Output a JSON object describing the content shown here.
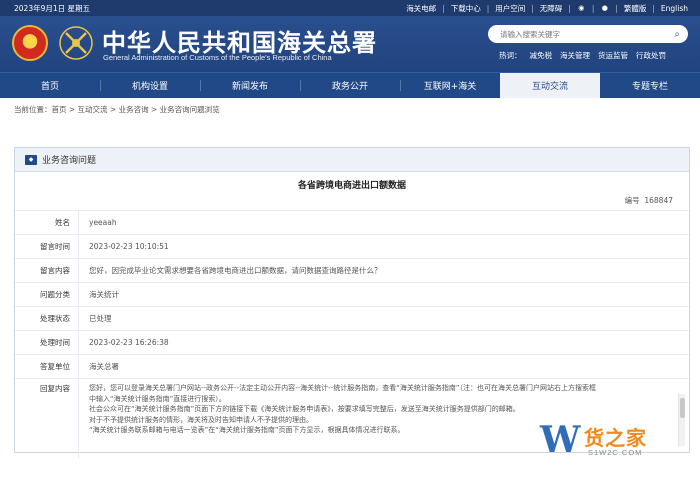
{
  "topbar": {
    "date": "2023年9月1日 星期五",
    "links": [
      "海关电邮",
      "下载中心",
      "用户空间",
      "无障碍"
    ],
    "lang_simplified": "繁體版",
    "lang_english": "English"
  },
  "header": {
    "title_cn": "中华人民共和国海关总署",
    "title_en": "General Administration of Customs of the People's Republic of China",
    "search_placeholder": "请输入搜索关键字",
    "hot_label": "热词：",
    "hot_words": [
      "减免税",
      "海关管理",
      "货运监管",
      "行政处罚"
    ]
  },
  "nav": {
    "items": [
      "首页",
      "机构设置",
      "新闻发布",
      "政务公开",
      "互联网+海关",
      "互动交流",
      "专题专栏"
    ],
    "active": "互动交流"
  },
  "breadcrumb": "当前位置：首页 > 互动交流 > 业务咨询 > 业务咨询问题浏览",
  "panel": {
    "title": "业务咨询问题",
    "question_title": "各省跨境电商进出口额数据",
    "serial_label": "编号",
    "serial_value": "168847",
    "rows": [
      {
        "label": "姓名",
        "value": "yeeaah"
      },
      {
        "label": "留言时间",
        "value": "2023-02-23 10:10:51"
      },
      {
        "label": "留言内容",
        "value": "您好，因完成毕业论文需求想要各省跨境电商进出口额数据，请问数据查询路径是什么？"
      },
      {
        "label": "问题分类",
        "value": "海关统计"
      },
      {
        "label": "处理状态",
        "value": "已处理"
      },
      {
        "label": "处理时间",
        "value": "2023-02-23 16:26:38"
      },
      {
        "label": "答复单位",
        "value": "海关总署"
      }
    ],
    "reply_label": "回复内容",
    "reply_lines": [
      "您好，您可以登录海关总署门户网站--政务公开--法定主动公开内容--海关统计--统计服务指南，查看“海关统计服务指南”（注：也可在海关总署门户网站右上方搜索框",
      "中输入“海关统计服务指南”直接进行搜索）。",
      "社会公众可在“海关统计服务指南”页面下方的链接下载《海关统计服务申请表》，按要求填写完整后，发送至海关统计服务提供部门的邮箱。",
      "对于不予提供统计服务的情形，海关将及时告知申请人不予提供的理由。",
      "“海关统计服务联系邮箱与电话一览表”在“海关统计服务指南”页面下方显示，根据具体情况进行联系。"
    ]
  },
  "watermark": {
    "cn": "货之家",
    "url": "S1W2C.COM"
  }
}
